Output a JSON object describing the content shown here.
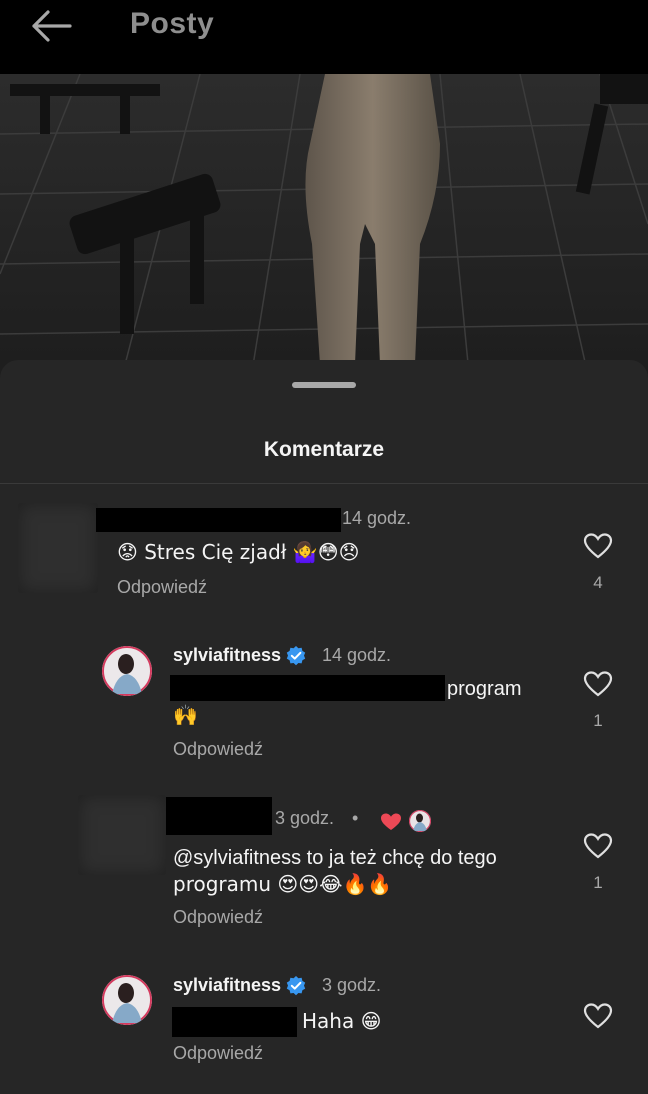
{
  "header": {
    "title": "Posty"
  },
  "sheet": {
    "title": "Komentarze"
  },
  "comments": [
    {
      "time": "14 godz.",
      "text": "😟 Stres Cię zjadł 🤷‍♀️😳😞",
      "reply_label": "Odpowiedź",
      "likes": "4"
    },
    {
      "username": "sylviafitness",
      "time": "14 godz.",
      "text_line1": "program",
      "text_line2": "🙌",
      "reply_label": "Odpowiedź",
      "likes": "1"
    },
    {
      "time": "3 godz.",
      "separator": "•",
      "text_line1": "@sylviafitness to ja też chcę do tego",
      "text_line2": "programu 😍😍😂🔥🔥",
      "reply_label": "Odpowiedź",
      "likes": "1"
    },
    {
      "username": "sylviafitness",
      "time": "3 godz.",
      "text": "Haha 😁",
      "reply_label": "Odpowiedź"
    }
  ],
  "colors": {
    "background": "#262626",
    "topbar": "#000000",
    "verified": "#3897f0",
    "liked_heart": "#ed4956",
    "secondary_text": "#a8a8a8"
  }
}
